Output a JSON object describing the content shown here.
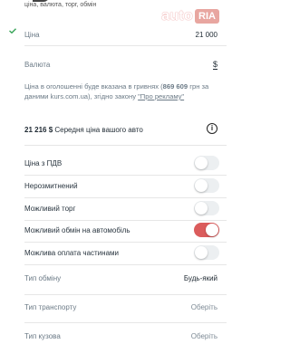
{
  "header": {
    "subtitle": "ціна, валюта, торг, обмін",
    "logo_auto": "auto",
    "logo_ria": "RIA"
  },
  "price": {
    "label": "Ціна",
    "value": "21 000"
  },
  "currency": {
    "label": "Валюта",
    "symbol": "$"
  },
  "info": {
    "text_before": "Ціна в оголошенні буде вказана в гривнях (",
    "uah_amount": "869 609",
    "text_mid": " грн за даними kurs.com.ua), згідно закону ",
    "law_link": "\"Про рекламу\""
  },
  "average": {
    "amount": "21 216 $",
    "text": " Середня ціна вашого авто"
  },
  "toggles": [
    {
      "label": "Ціна з ПДВ",
      "on": false
    },
    {
      "label": "Нерозмитнений",
      "on": false
    },
    {
      "label": "Можливий торг",
      "on": false
    },
    {
      "label": "Можливий обмін на автомобіль",
      "on": true
    },
    {
      "label": "Можлива оплата частинами",
      "on": false
    }
  ],
  "selects": [
    {
      "label": "Тип обміну",
      "value": "Будь-який"
    },
    {
      "label": "Тип транспорту",
      "value": "Оберіть"
    },
    {
      "label": "Тип кузова",
      "value": "Оберіть"
    }
  ],
  "colors": {
    "toggle_on": "#db5c5c",
    "toggle_off": "#eceff1",
    "check": "#3aa55a"
  }
}
